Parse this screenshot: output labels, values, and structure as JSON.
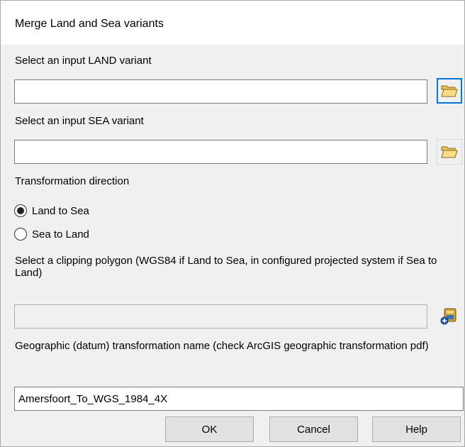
{
  "window": {
    "title": "Merge Land and Sea variants"
  },
  "land": {
    "label": "Select an input LAND variant",
    "value": "",
    "browse_icon": "folder-open-icon"
  },
  "sea": {
    "label": "Select an input SEA variant",
    "value": "",
    "browse_icon": "folder-open-icon"
  },
  "direction": {
    "label": "Transformation direction",
    "options": [
      {
        "label": "Land to Sea",
        "selected": true
      },
      {
        "label": "Sea to Land",
        "selected": false
      }
    ]
  },
  "clip": {
    "label": "Select a clipping polygon (WGS84 if Land to Sea, in configured projected system if Sea to Land)",
    "value": "",
    "browse_icon": "add-data-icon"
  },
  "geo": {
    "label": "Geographic (datum) transformation name (check ArcGIS geographic transformation pdf)",
    "value": "Amersfoort_To_WGS_1984_4X"
  },
  "buttons": {
    "ok": "OK",
    "cancel": "Cancel",
    "help": "Help"
  },
  "colors": {
    "focus": "#0078d7",
    "folder": "#f4d57a",
    "background": "#f0f0f0"
  }
}
